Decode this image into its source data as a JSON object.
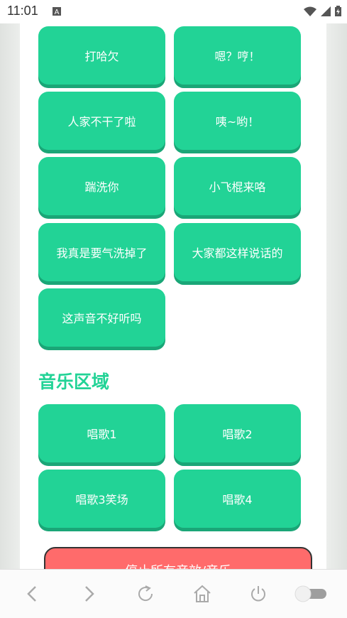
{
  "status_bar": {
    "time": "11:01"
  },
  "sound_buttons": [
    {
      "label": "打哈欠"
    },
    {
      "label": "嗯？哼！"
    },
    {
      "label": "人家不干了啦"
    },
    {
      "label": "咦~哟！"
    },
    {
      "label": "踹洗你"
    },
    {
      "label": "小飞棍来咯"
    },
    {
      "label": "我真是要气洗掉了"
    },
    {
      "label": "大家都这样说话的"
    },
    {
      "label": "这声音不好听吗"
    }
  ],
  "music_section": {
    "title": "音乐区域",
    "buttons": [
      {
        "label": "唱歌1"
      },
      {
        "label": "唱歌2"
      },
      {
        "label": "唱歌3笑场"
      },
      {
        "label": "唱歌4"
      }
    ]
  },
  "stop_button": {
    "label": "停止所有音效/音乐"
  },
  "colors": {
    "accent": "#22d396",
    "accent_shadow": "#1aa677",
    "stop": "#ff6b6b"
  }
}
